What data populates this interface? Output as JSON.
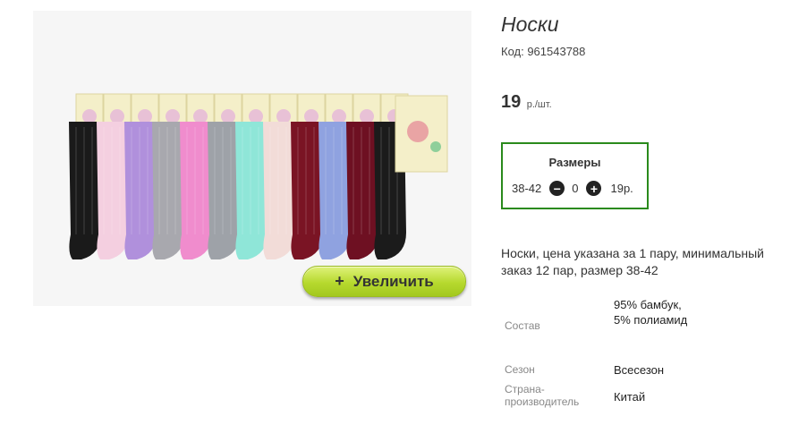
{
  "product": {
    "title": "Носки",
    "code": "Код: 961543788",
    "price_value": "19",
    "price_unit": "р./шт."
  },
  "zoom_button": {
    "icon": "+",
    "label": "Увеличить"
  },
  "sizes": {
    "title": "Размеры",
    "size": "38-42",
    "quantity": "0",
    "price": "19р."
  },
  "description": "Носки, цена указана за 1 пару, минимальный заказ 12 пар, размер 38-42",
  "properties": [
    {
      "label": "Состав",
      "value": "95% бамбук, 5% полиамид"
    },
    {
      "label": "Сезон",
      "value": "Всесезон"
    },
    {
      "label": "Страна-производитель",
      "value": "Китай"
    }
  ],
  "sock_colors": [
    "#1a1a1a",
    "#f4cfe0",
    "#b090dc",
    "#a8a8ae",
    "#f08ccd",
    "#9ea2a8",
    "#8fe6d8",
    "#f2dcd8",
    "#7a1424",
    "#8fa2e0",
    "#6e1022",
    "#1b1b1b"
  ]
}
